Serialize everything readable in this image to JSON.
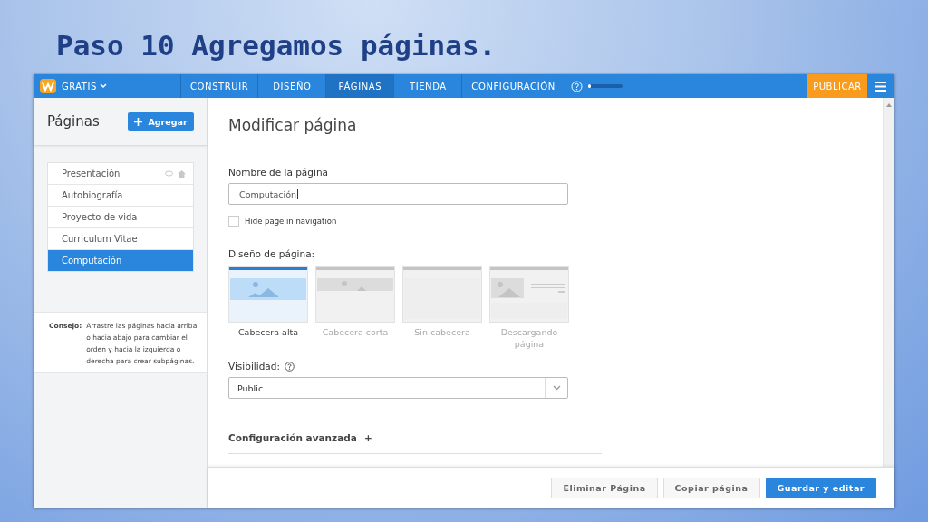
{
  "slide_title": "Paso 10 Agregamos páginas.",
  "topbar": {
    "plan": "GRATIS",
    "tabs": [
      {
        "label": "CONSTRUIR",
        "selected": false
      },
      {
        "label": "DISEÑO",
        "selected": false
      },
      {
        "label": "PÁGINAS",
        "selected": true
      },
      {
        "label": "TIENDA",
        "selected": false
      },
      {
        "label": "CONFIGURACIÓN",
        "selected": false
      }
    ],
    "progress": {
      "level": 0.05
    },
    "publish": "PUBLICAR"
  },
  "sidebar": {
    "title": "Páginas",
    "add_button": "Agregar",
    "pages": [
      {
        "label": "Presentación",
        "selected": false,
        "home": true
      },
      {
        "label": "Autobiografía",
        "selected": false,
        "home": false
      },
      {
        "label": "Proyecto de vida",
        "selected": false,
        "home": false
      },
      {
        "label": "Curriculum Vitae",
        "selected": false,
        "home": false
      },
      {
        "label": "Computación",
        "selected": true,
        "home": false
      }
    ],
    "tip": {
      "label": "Consejo:",
      "text": "Arrastre las páginas hacia arriba o hacia abajo para cambiar el orden y hacia la izquierda o derecha para crear subpáginas."
    }
  },
  "main": {
    "heading": "Modificar página",
    "name_label": "Nombre de la página",
    "name_value": "Computación",
    "hide_checkbox": {
      "label": "Hide page in navigation",
      "checked": false
    },
    "layout_label": "Diseño de página:",
    "layouts": [
      {
        "label": "Cabecera alta",
        "kind": "tall",
        "selected": true
      },
      {
        "label": "Cabecera corta",
        "kind": "short",
        "selected": false
      },
      {
        "label": "Sin cabecera",
        "kind": "none",
        "selected": false
      },
      {
        "label": "Descargando página",
        "kind": "download",
        "selected": false
      }
    ],
    "visibility_label": "Visibilidad:",
    "visibility_value": "Public",
    "advanced": "Configuración avanzada",
    "advanced_toggle": "+"
  },
  "footer": {
    "buttons": [
      {
        "label": "Eliminar Página",
        "kind": "secondary"
      },
      {
        "label": "Copiar página",
        "kind": "secondary"
      },
      {
        "label": "Guardar y editar",
        "kind": "primary"
      }
    ]
  }
}
